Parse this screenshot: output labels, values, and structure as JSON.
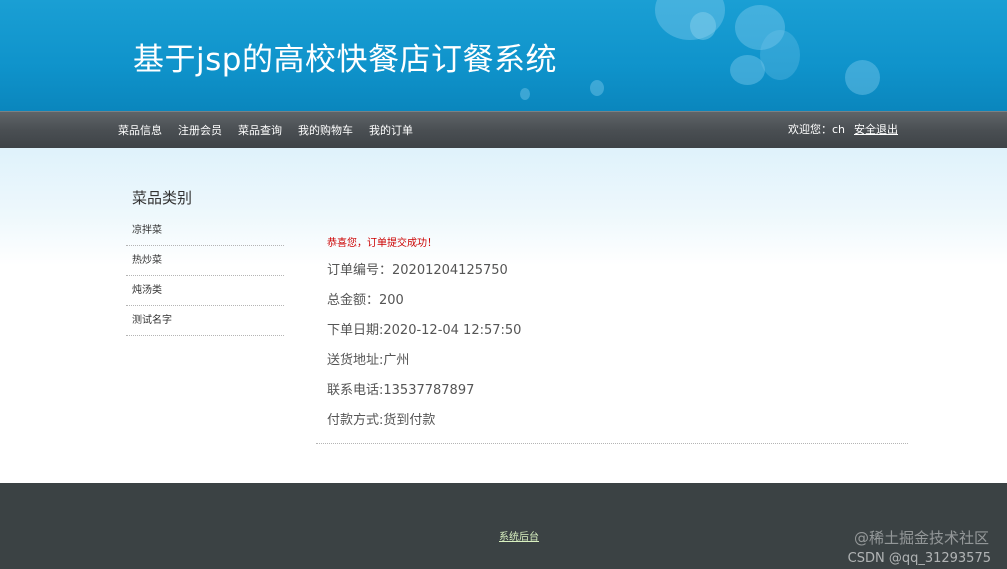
{
  "header": {
    "title": "基于jsp的高校快餐店订餐系统"
  },
  "nav": {
    "items": [
      {
        "label": "菜品信息"
      },
      {
        "label": "注册会员"
      },
      {
        "label": "菜品查询"
      },
      {
        "label": "我的购物车"
      },
      {
        "label": "我的订单"
      }
    ],
    "welcome": "欢迎您：ch",
    "logout_label": "安全退出"
  },
  "sidebar": {
    "title": "菜品类别",
    "items": [
      {
        "label": "凉拌菜"
      },
      {
        "label": "热炒菜"
      },
      {
        "label": "炖汤类"
      },
      {
        "label": "测试名字"
      }
    ]
  },
  "order": {
    "success_message": "恭喜您，订单提交成功！",
    "order_no": "订单编号：20201204125750",
    "total": "总金额：200",
    "order_date": "下单日期:2020-12-04 12:57:50",
    "address": "送货地址:广州",
    "phone": "联系电话:13537787897",
    "payment": "付款方式:货到付款"
  },
  "footer": {
    "admin_link": "系统后台",
    "watermark_top": "@稀土掘金技术社区",
    "watermark_bottom": "CSDN @qq_31293575"
  },
  "colors": {
    "banner_blue": "#0f93cb",
    "nav_gray": "#4a4f53",
    "footer_dark": "#3b4244",
    "success_red": "#cc0000"
  }
}
